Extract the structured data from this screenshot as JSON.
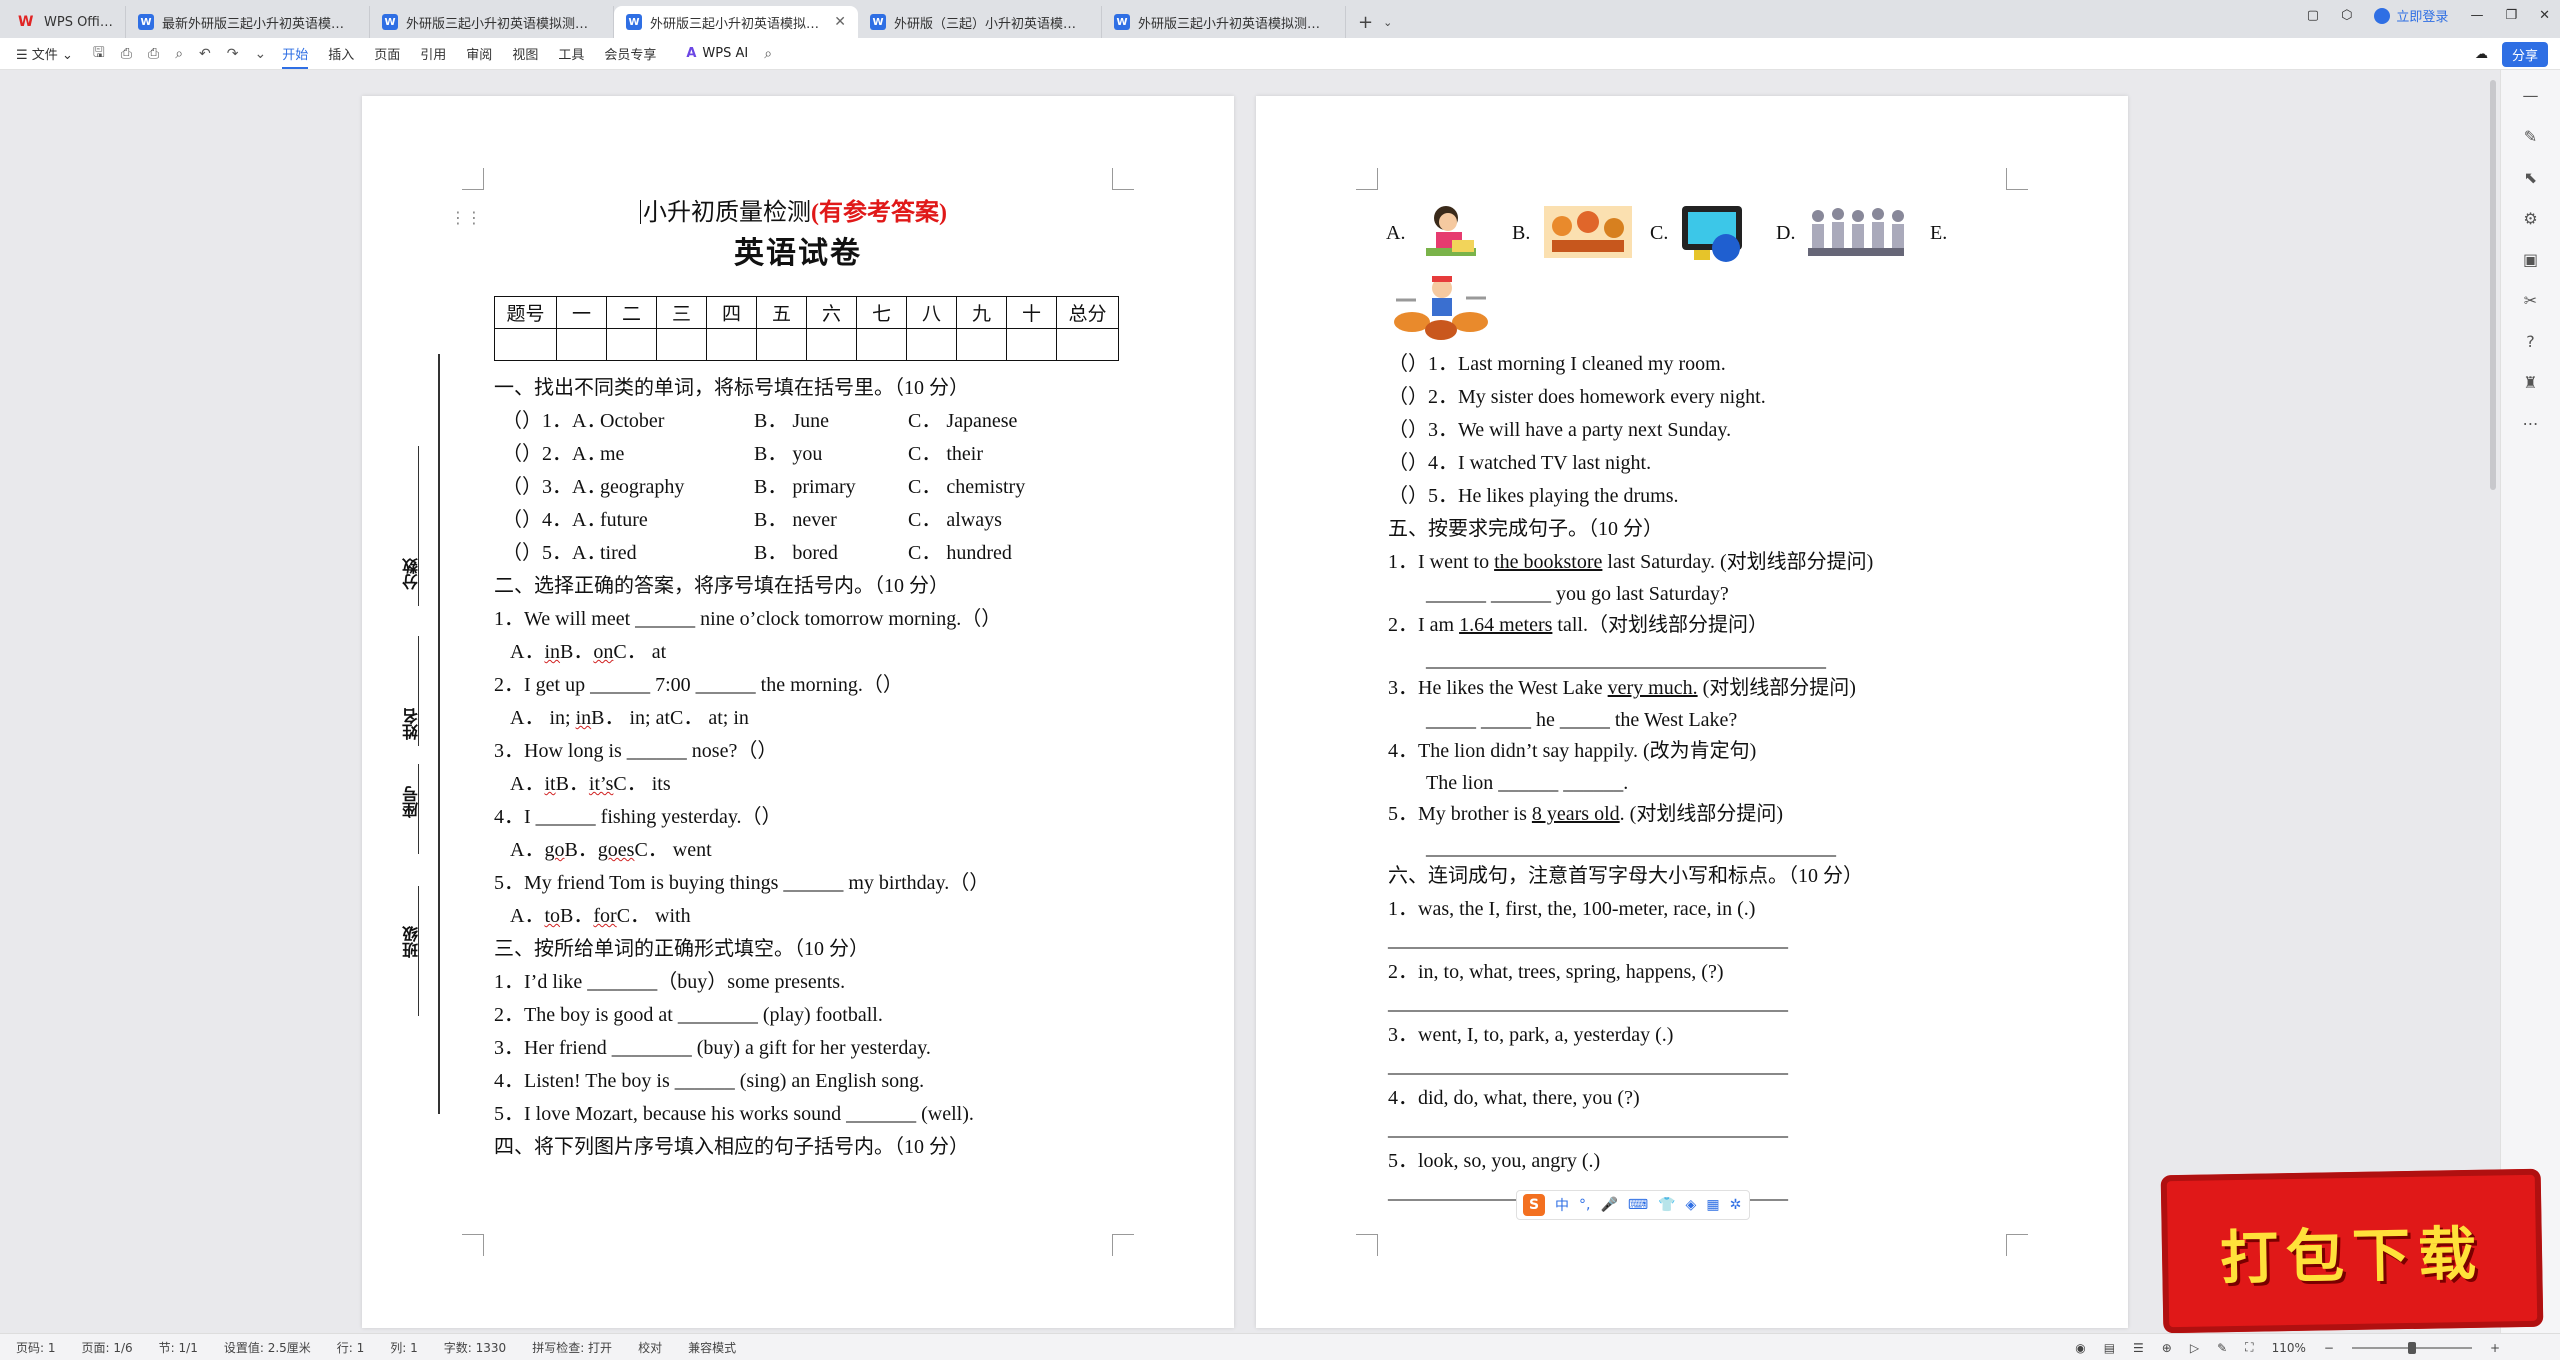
{
  "app": {
    "name": "WPS Office"
  },
  "tabs": [
    {
      "label": "最新外研版三起小升初英语模拟测试卷"
    },
    {
      "label": "外研版三起小升初英语模拟测试卷（含"
    },
    {
      "label": "外研版三起小升初英语模拟测试卷"
    },
    {
      "label": "外研版（三起）小升初英语模拟试卷"
    },
    {
      "label": "外研版三起小升初英语模拟测试卷（含"
    }
  ],
  "topright": {
    "login": "立即登录"
  },
  "toolbar": {
    "file": "文件",
    "items": [
      "开始",
      "插入",
      "页面",
      "引用",
      "审阅",
      "视图",
      "工具",
      "会员专享"
    ],
    "wps_ai": "WPS AI",
    "share": "分享"
  },
  "page1": {
    "title1": "小升初质量检测",
    "title1_red": "(有参考答案)",
    "title2": "英语试卷",
    "score_header": [
      "题号",
      "一",
      "二",
      "三",
      "四",
      "五",
      "六",
      "七",
      "八",
      "九",
      "十",
      "总分"
    ],
    "margin_labels": [
      "分数",
      "姓名",
      "座号",
      "班级"
    ],
    "s1_title": "一、找出不同类的单词，将标号填在括号里。（10 分）",
    "s1_rows": [
      {
        "n": "（）1．A．",
        "a": "October",
        "b": "B．  June",
        "c": "C．  Japanese"
      },
      {
        "n": "（）2．A．",
        "a": "me",
        "b": "B．  you",
        "c": "C．  their"
      },
      {
        "n": "（）3．A．",
        "a": "geography",
        "b": "B．  primary",
        "c": "C．  chemistry"
      },
      {
        "n": "（）4．A．",
        "a": "future",
        "b": "B．  never",
        "c": "C．  always"
      },
      {
        "n": "（）5．A．",
        "a": "tired",
        "b": "B．  bored",
        "c": "C．  hundred"
      }
    ],
    "s2_title": "二、选择正确的答案，将序号填在括号内。（10 分）",
    "s2": [
      {
        "q": "1．We will meet ______ nine o’clock tomorrow morning.（）",
        "a1": "A．",
        "w1": "in",
        "a2": "B．",
        "w2": "on",
        "a3": "C．  at"
      },
      {
        "q": "2．I get up ______ 7:00 ______ the morning.（）",
        "a1": "A．  in; ",
        "w1": "in",
        "a2": "B．  in; at",
        "w2": "",
        "a3": "C．  at; in"
      },
      {
        "q": "3．How long is ______ nose?（）",
        "a1": "A．",
        "w1": "it",
        "a2": "B．",
        "w2": "it’s",
        "a3": "C．  its"
      },
      {
        "q": "4．I ______ fishing yesterday.（）",
        "a1": "A．",
        "w1": "go",
        "a2": "B．",
        "w2": "goes",
        "a3": "C．  went"
      },
      {
        "q": "5．My friend Tom is buying things ______ my birthday.（）",
        "a1": "A．",
        "w1": "to",
        "a2": "B．",
        "w2": "for",
        "a3": "C．  with"
      }
    ],
    "s3_title": "三、按所给单词的正确形式填空。（10 分）",
    "s3": [
      "1．I’d like _______（buy）some presents.",
      "2．The boy is good at ________ (play) football.",
      "3．Her friend ________ (buy) a gift for her yesterday.",
      "4．Listen! The boy is ______ (sing) an English song.",
      "5．I love Mozart, because his works sound _______ (well)."
    ],
    "s4_title": "四、将下列图片序号填入相应的句子括号内。（10 分）"
  },
  "page2": {
    "pic_labels": [
      "A.",
      "B.",
      "C.",
      "D.",
      "E."
    ],
    "pic_icons": [
      "girl-cleaning-picture-icon",
      "party-picture-icon",
      "tv-picture-icon",
      "classroom-picture-icon",
      "drums-picture-icon"
    ],
    "s4_items": [
      "（）1．Last morning I cleaned my room.",
      "（）2．My sister does homework every night.",
      "（）3．We will have a party next Sunday.",
      "（）4．I watched TV last night.",
      "（）5．He likes playing the drums."
    ],
    "s5_title": "五、按要求完成句子。（10 分）",
    "s5": [
      {
        "pre": "1．I went to ",
        "u": "the bookstore",
        "post": " last Saturday. (对划线部分提问)",
        "ans": "______ ______ you go last Saturday?"
      },
      {
        "pre": "2．I am ",
        "u": "1.64 meters",
        "post": " tall.（对划线部分提问）",
        "ans": "________________________________________"
      },
      {
        "pre": "3．He likes the West Lake ",
        "u": "very much.",
        "post": " (对划线部分提问)",
        "ans": "_____ _____ he _____ the West Lake?"
      },
      {
        "pre": "4．The lion didn’t say happily. (改为肯定句)",
        "u": "",
        "post": "",
        "ans": "The lion ______ ______."
      },
      {
        "pre": "5．My brother is ",
        "u": "8 years old",
        "post": ". (对划线部分提问)",
        "ans": "_________________________________________"
      }
    ],
    "s6_title": "六、连词成句，注意首写字母大小写和标点。（10 分）",
    "s6": [
      "1．was, the I, first, the, 100-meter, race, in (.)",
      "2．in, to, what, trees, spring, happens, (?)",
      "3．went, I, to, park, a, yesterday (.)",
      "4．did, do, what, there, you (?)",
      "5．look, so, you, angry (.)"
    ],
    "blank": "________________________________________"
  },
  "ime": {
    "mode": "中"
  },
  "stamp": {
    "text": "打包下载"
  },
  "status": {
    "page": "页码: 1",
    "pages": "页面: 1/6",
    "section": "节: 1/1",
    "setting": "设置值: 2.5厘米",
    "row": "行: 1",
    "col": "列: 1",
    "words": "字数: 1330",
    "spell": "拼写检查: 打开",
    "proof": "校对",
    "compat": "兼容模式",
    "zoom": "110%"
  }
}
